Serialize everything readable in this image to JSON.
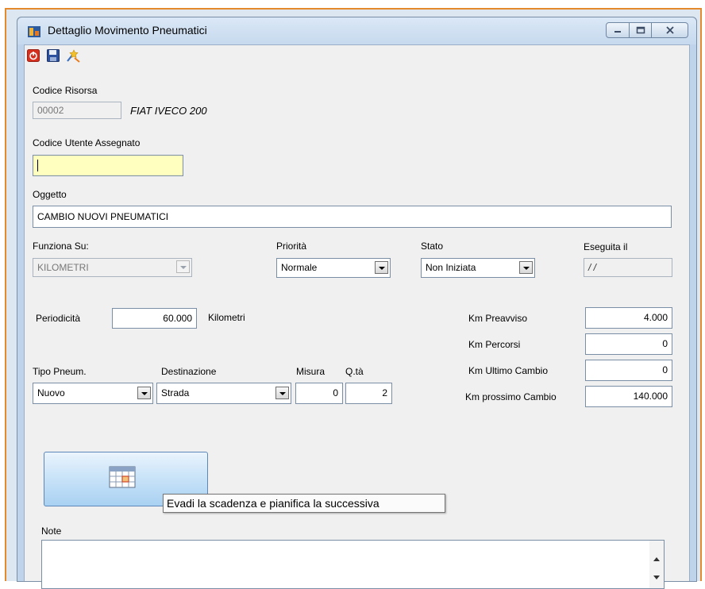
{
  "window": {
    "title": "Dettaglio Movimento Pneumatici",
    "title_icon": "vehicle-app-icon",
    "min_icon": "minimize-icon",
    "max_icon": "maximize-icon",
    "close_icon": "close-icon"
  },
  "toolbar": {
    "icons": [
      "power-off-icon",
      "save-icon",
      "wizard-icon"
    ]
  },
  "risorsa": {
    "label": "Codice Risorsa",
    "code": "00002",
    "description": "FIAT IVECO 200"
  },
  "utente": {
    "label": "Codice Utente Assegnato",
    "value": ""
  },
  "oggetto": {
    "label": "Oggetto",
    "value": "CAMBIO NUOVI PNEUMATICI"
  },
  "funziona_su": {
    "label": "Funziona Su:",
    "value": "KILOMETRI"
  },
  "priorita": {
    "label": "Priorità",
    "value": "Normale"
  },
  "stato": {
    "label": "Stato",
    "value": "Non Iniziata"
  },
  "eseguita": {
    "label": "Eseguita il",
    "value": "/ /"
  },
  "periodicita": {
    "label": "Periodicità",
    "value": "60.000",
    "unit": "Kilometri"
  },
  "km": {
    "preavviso_label": "Km Preavviso",
    "preavviso": "4.000",
    "percorsi_label": "Km Percorsi",
    "percorsi": "0",
    "ultimo_label": "Km Ultimo Cambio",
    "ultimo": "0",
    "prossimo_label": "Km prossimo Cambio",
    "prossimo": "140.000"
  },
  "pneumatici": {
    "tipo_label": "Tipo Pneum.",
    "tipo": "Nuovo",
    "destinazione_label": "Destinazione",
    "destinazione": "Strada",
    "misura_label": "Misura",
    "misura": "0",
    "qta_label": "Q.tà",
    "qta": "2"
  },
  "action": {
    "icon": "calendar-icon",
    "tooltip": "Evadi la scadenza e pianifica la successiva"
  },
  "note": {
    "label": "Note",
    "value": ""
  },
  "colors": {
    "accent_border": "#e58a2c",
    "input_yellow": "#ffffc0",
    "button_blue": "#c7e2f8"
  }
}
